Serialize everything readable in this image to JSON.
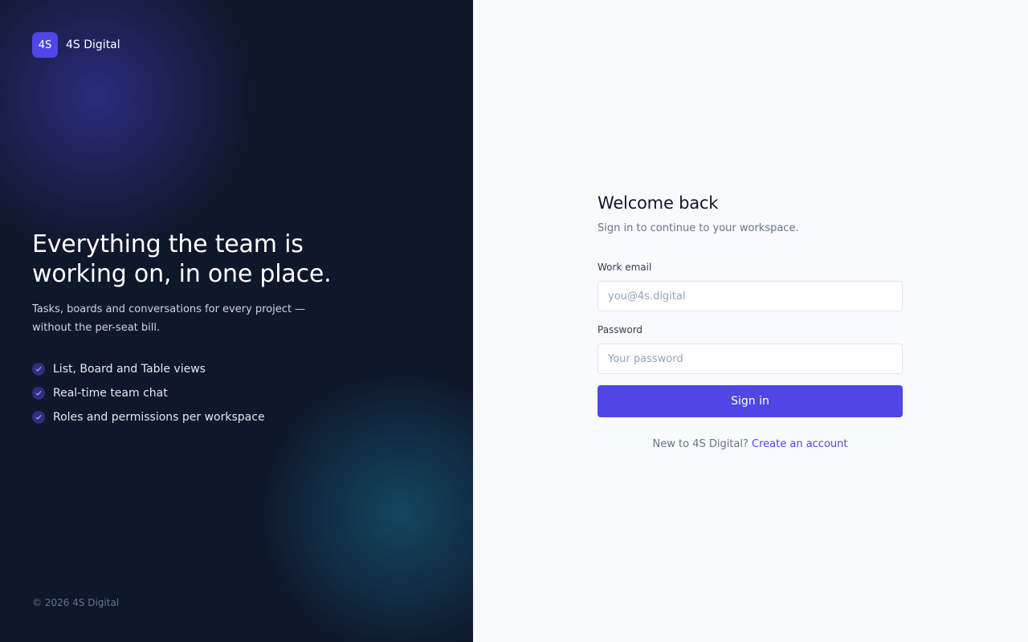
{
  "brand": {
    "logo_text": "4S",
    "name": "4S Digital"
  },
  "hero": {
    "title_line1": "Everything the team is",
    "title_line2": "working on, in one place.",
    "description": "Tasks, boards and conversations for every project — without the per-seat bill."
  },
  "features": [
    {
      "label": "List, Board and Table views",
      "icon": "check-icon"
    },
    {
      "label": "Real-time team chat",
      "icon": "check-icon"
    },
    {
      "label": "Roles and permissions per workspace",
      "icon": "check-icon"
    }
  ],
  "footer": {
    "copyright": "© 2026 4S Digital"
  },
  "login": {
    "title": "Welcome back",
    "subtitle": "Sign in to continue to your workspace.",
    "email_label": "Work email",
    "email_placeholder": "you@4s.digital",
    "email_value": "",
    "password_label": "Password",
    "password_placeholder": "Your password",
    "password_value": "",
    "submit_label": "Sign in",
    "signup_prompt": "New to 4S Digital?",
    "signup_link": "Create an account"
  },
  "colors": {
    "accent": "#4f46e5",
    "left_panel_bg": "#0f172a",
    "right_panel_bg": "#f8fafc"
  }
}
